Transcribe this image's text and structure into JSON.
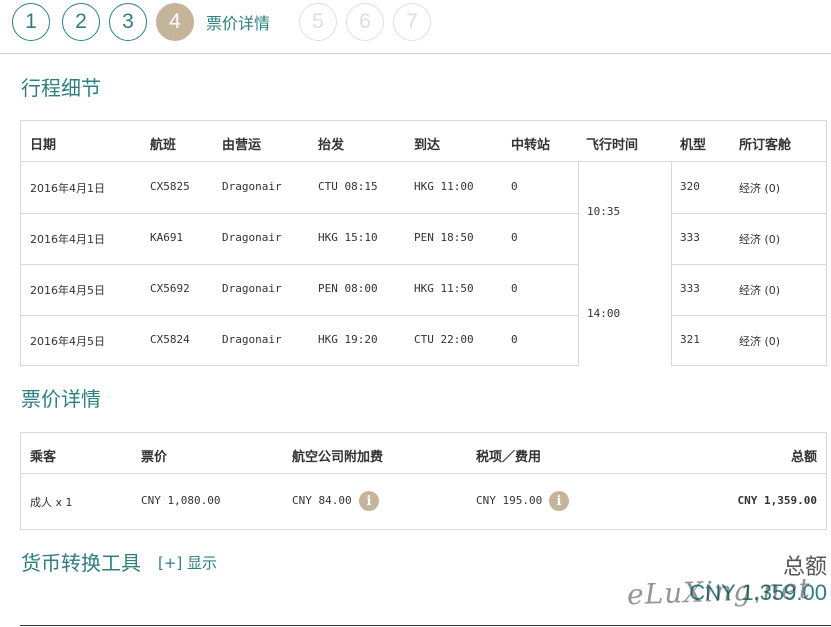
{
  "steps": {
    "items": [
      "1",
      "2",
      "3",
      "4",
      "5",
      "6",
      "7"
    ],
    "current_label": "票价详情"
  },
  "itinerary": {
    "title": "行程细节",
    "headers": {
      "date": "日期",
      "flight": "航班",
      "operator": "由营运",
      "depart": "抬发",
      "arrive": "到达",
      "stops": "中转站",
      "duration": "飞行时间",
      "aircraft": "机型",
      "cabin": "所订客舱"
    },
    "rows": [
      {
        "date": "2016年4月1日",
        "flight": "CX5825",
        "operator": "Dragonair",
        "depart": "CTU 08:15",
        "arrive": "HKG 11:00",
        "stops": "0",
        "aircraft": "320",
        "cabin": "经济 (0)"
      },
      {
        "date": "2016年4月1日",
        "flight": "KA691",
        "operator": "Dragonair",
        "depart": "HKG 15:10",
        "arrive": "PEN 18:50",
        "stops": "0",
        "aircraft": "333",
        "cabin": "经济 (0)"
      },
      {
        "date": "2016年4月5日",
        "flight": "CX5692",
        "operator": "Dragonair",
        "depart": "PEN 08:00",
        "arrive": "HKG 11:50",
        "stops": "0",
        "aircraft": "333",
        "cabin": "经济 (0)"
      },
      {
        "date": "2016年4月5日",
        "flight": "CX5824",
        "operator": "Dragonair",
        "depart": "HKG 19:20",
        "arrive": "CTU 22:00",
        "stops": "0",
        "aircraft": "321",
        "cabin": "经济 (0)"
      }
    ],
    "durations": [
      "10:35",
      "14:00"
    ]
  },
  "fare": {
    "title": "票价详情",
    "headers": {
      "passenger": "乘客",
      "fare": "票价",
      "surcharge": "航空公司附加费",
      "taxes": "税项／费用",
      "total": "总额"
    },
    "row": {
      "passenger": "成人 x 1",
      "fare": "CNY 1,080.00",
      "surcharge": "CNY 84.00",
      "taxes": "CNY 195.00",
      "total": "CNY 1,359.00"
    },
    "info_icon_glyph": "i"
  },
  "currency": {
    "title": "货币转换工具",
    "toggle": "[+] 显示",
    "total_label": "总额",
    "total_value": "CNY 1,359.00"
  },
  "watermark": "eLuXing.net",
  "colors": {
    "accent": "#2f7f80",
    "active_step": "#c4b59a",
    "border": "#d8d8d8"
  }
}
